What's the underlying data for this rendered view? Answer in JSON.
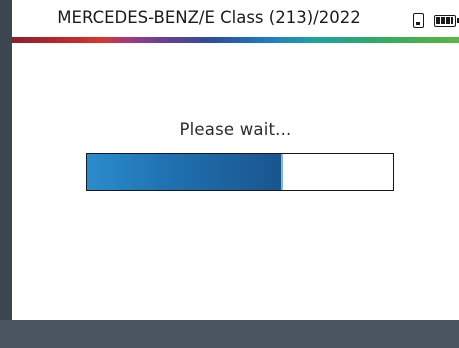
{
  "header": {
    "title": "MERCEDES-BENZ/E Class (213)/2022",
    "icons": [
      "sim-card-icon",
      "battery-icon"
    ]
  },
  "status": {
    "message": "Please wait...",
    "progress_fraction": 0.64
  },
  "colors": {
    "frame": "#3c4650",
    "footer": "#4a5560",
    "progress_fill": "#1f6faf"
  }
}
